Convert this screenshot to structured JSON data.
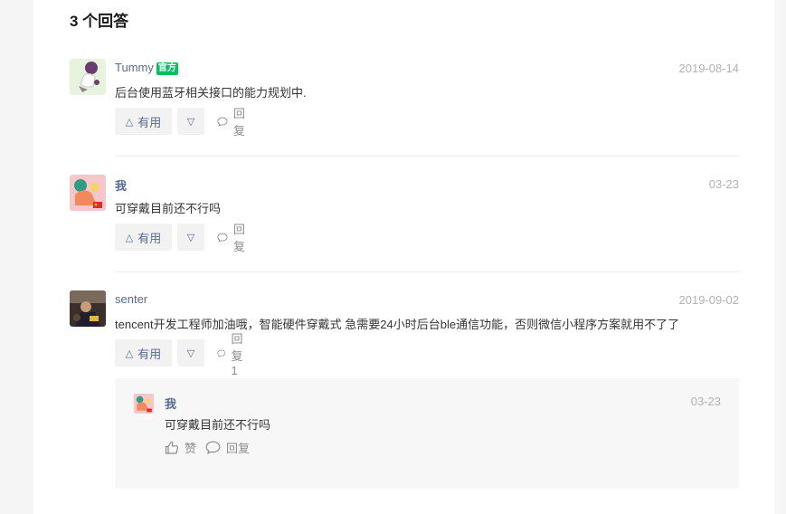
{
  "section": {
    "heading": "3 个回答"
  },
  "answers": [
    {
      "author": "Tummy",
      "badge": "官方",
      "date": "2019-08-14",
      "content": "后台使用蓝牙相关接口的能力规划中.",
      "useful_label": "有用",
      "reply_label": "回复"
    },
    {
      "author": "我",
      "date": "03-23",
      "content": "可穿戴目前还不行吗",
      "useful_label": "有用",
      "reply_label": "回复"
    },
    {
      "author": "senter",
      "date": "2019-09-02",
      "content": "tencent开发工程师加油哦，智能硬件穿戴式 急需要24小时后台ble通信功能，否则微信小程序方案就用不了了",
      "useful_label": "有用",
      "reply_label": "回复 1",
      "reply": {
        "author": "我",
        "date": "03-23",
        "content": "可穿戴目前还不行吗",
        "like_label": "赞",
        "reply_label": "回复"
      }
    }
  ],
  "icons": {
    "useful": "triangle-up-icon",
    "not_useful": "triangle-down-icon",
    "reply": "comment-bubble-icon",
    "like": "thumbs-up-icon"
  },
  "colors": {
    "link": "#576b95",
    "official_badge": "#07c160",
    "muted": "#b2b2b2"
  }
}
